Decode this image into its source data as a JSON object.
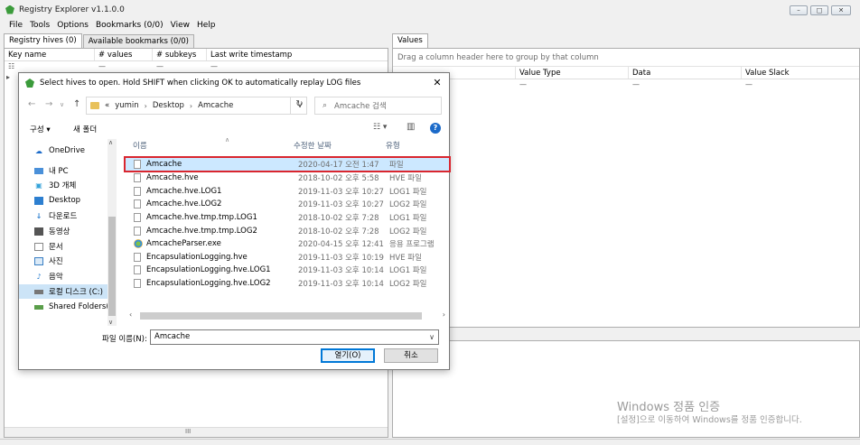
{
  "app": {
    "title": "Registry Explorer v1.1.0.0"
  },
  "menu": [
    "File",
    "Tools",
    "Options",
    "Bookmarks (0/0)",
    "View",
    "Help"
  ],
  "left": {
    "tabs": [
      "Registry hives (0)",
      "Available bookmarks (0/0)"
    ],
    "columns": [
      "Key name",
      "# values",
      "# subkeys",
      "Last write timestamp"
    ],
    "filter_row": [
      "—",
      "—",
      "—"
    ],
    "scroll_marker": "III"
  },
  "right": {
    "tab": "Values",
    "group_hint": "Drag a column header here to group by that column",
    "columns": [
      "Value Type",
      "Data",
      "Value Slack"
    ],
    "filter_row": [
      "—",
      "—",
      "—"
    ]
  },
  "watermark": {
    "title": "Windows 정품 인증",
    "subtitle": "[설정]으로 이동하여 Windows를 정품 인증합니다."
  },
  "dialog": {
    "title": "Select hives to open. Hold SHIFT when clicking OK to automatically replay LOG files",
    "breadcrumbs": [
      "«",
      "yumin",
      "Desktop",
      "Amcache"
    ],
    "search_placeholder": "Amcache 검색",
    "organize": "구성 ▾",
    "new_folder": "새 폴더",
    "nav_tree": [
      {
        "label": "OneDrive",
        "icon": "onedrive-icon",
        "selected": false
      },
      {
        "label": "내 PC",
        "icon": "pc-icon",
        "selected": false
      },
      {
        "label": "3D 개체",
        "icon": "3d-objects-icon",
        "selected": false
      },
      {
        "label": "Desktop",
        "icon": "desktop-icon",
        "selected": false
      },
      {
        "label": "다운로드",
        "icon": "download-icon",
        "selected": false
      },
      {
        "label": "동영상",
        "icon": "video-icon",
        "selected": false
      },
      {
        "label": "문서",
        "icon": "document-icon",
        "selected": false
      },
      {
        "label": "사진",
        "icon": "picture-icon",
        "selected": false
      },
      {
        "label": "음악",
        "icon": "music-icon",
        "selected": false
      },
      {
        "label": "로컬 디스크 (C:)",
        "icon": "local-disk-icon",
        "selected": true
      },
      {
        "label": "Shared Folders(\\",
        "icon": "network-drive-icon",
        "selected": false
      }
    ],
    "columns": {
      "name": "이름",
      "date": "수정한 날짜",
      "type": "유형"
    },
    "files": [
      {
        "name": "Amcache",
        "date": "2020-04-17 오전 1:47",
        "type": "파일",
        "icon": "file-icon",
        "selected": true
      },
      {
        "name": "Amcache.hve",
        "date": "2018-10-02 오후 5:58",
        "type": "HVE 파일",
        "icon": "file-icon",
        "selected": false
      },
      {
        "name": "Amcache.hve.LOG1",
        "date": "2019-11-03 오후 10:27",
        "type": "LOG1 파일",
        "icon": "file-icon",
        "selected": false
      },
      {
        "name": "Amcache.hve.LOG2",
        "date": "2019-11-03 오후 10:27",
        "type": "LOG2 파일",
        "icon": "file-icon",
        "selected": false
      },
      {
        "name": "Amcache.hve.tmp.tmp.LOG1",
        "date": "2018-10-02 오후 7:28",
        "type": "LOG1 파일",
        "icon": "file-icon",
        "selected": false
      },
      {
        "name": "Amcache.hve.tmp.tmp.LOG2",
        "date": "2018-10-02 오후 7:28",
        "type": "LOG2 파일",
        "icon": "file-icon",
        "selected": false
      },
      {
        "name": "AmcacheParser.exe",
        "date": "2020-04-15 오후 12:41",
        "type": "응용 프로그램",
        "icon": "exe-icon",
        "selected": false
      },
      {
        "name": "EncapsulationLogging.hve",
        "date": "2019-11-03 오후 10:19",
        "type": "HVE 파일",
        "icon": "file-icon",
        "selected": false
      },
      {
        "name": "EncapsulationLogging.hve.LOG1",
        "date": "2019-11-03 오후 10:14",
        "type": "LOG1 파일",
        "icon": "file-icon",
        "selected": false
      },
      {
        "name": "EncapsulationLogging.hve.LOG2",
        "date": "2019-11-03 오후 10:14",
        "type": "LOG2 파일",
        "icon": "file-icon",
        "selected": false
      }
    ],
    "filename_label": "파일 이름(N):",
    "filename_value": "Amcache",
    "open_button": "열기(O)",
    "cancel_button": "취소",
    "accent_color": "#0078d7",
    "highlight_border_color": "#d9262f"
  }
}
